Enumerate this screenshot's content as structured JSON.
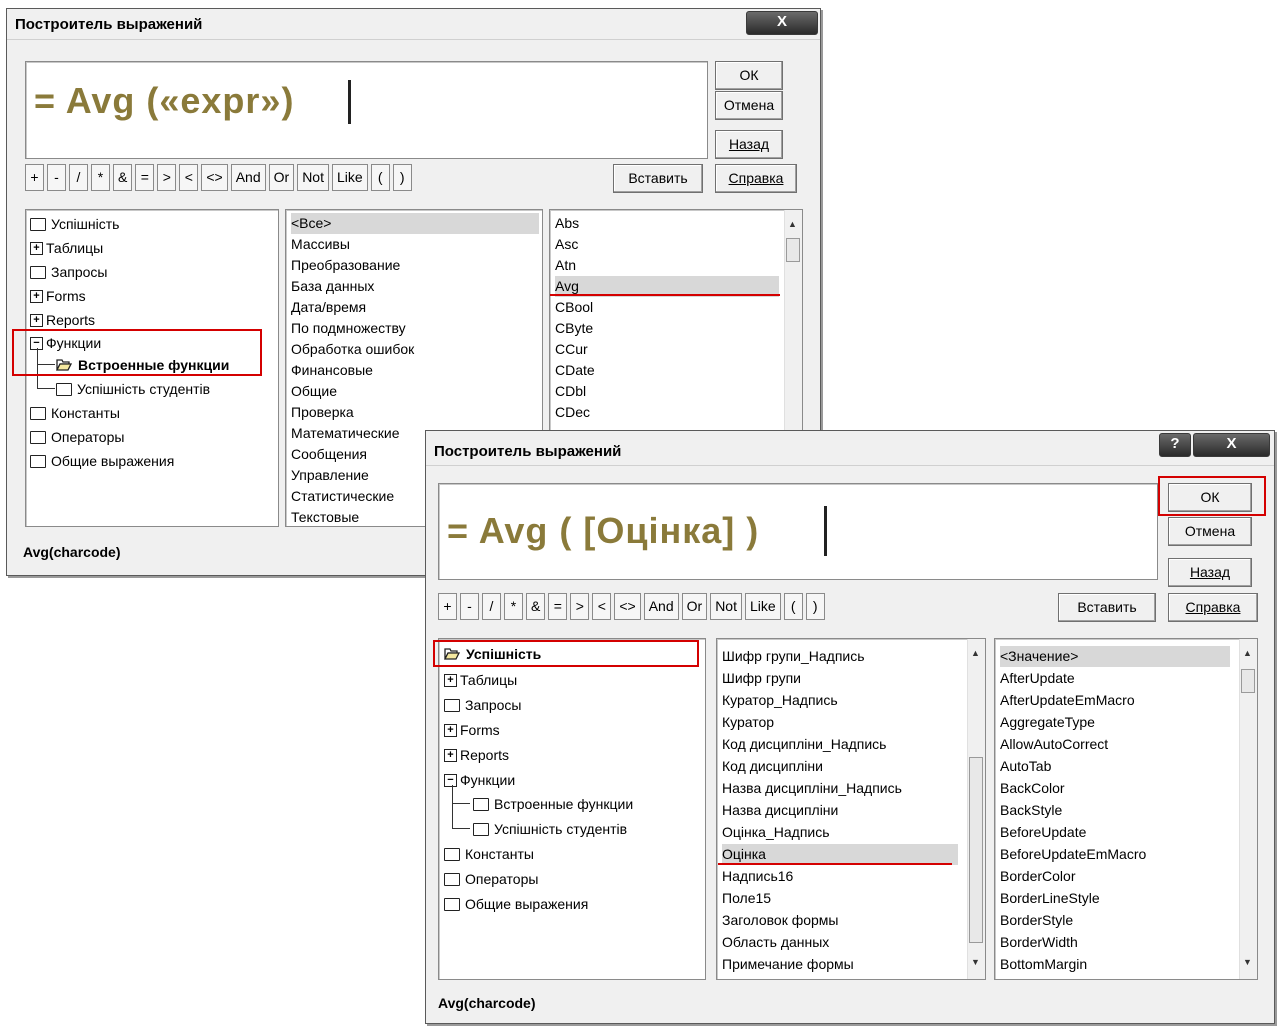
{
  "colors": {
    "highlight": "#d40000",
    "expr_text": "#8a7a3a"
  },
  "dialog1": {
    "title": "Построитель выражений",
    "close_label": "X",
    "expression": "= Avg («expr»)",
    "buttons": {
      "ok": "ОК",
      "cancel": "Отмена",
      "back": "Назад",
      "paste": "Вставить",
      "help": "Справка"
    },
    "operators": [
      "+",
      "-",
      "/",
      "*",
      "&",
      "=",
      ">",
      "<",
      "<>",
      "And",
      "Or",
      "Not",
      "Like",
      "(",
      ")"
    ],
    "tree": [
      "Успішність",
      "Таблицы",
      "Запросы",
      "Forms",
      "Reports",
      "Функции",
      "Встроенные функции",
      "Успішність студентів",
      "Константы",
      "Операторы",
      "Общие выражения"
    ],
    "categories": [
      "<Все>",
      "Массивы",
      "Преобразование",
      "База данных",
      "Дата/время",
      "По подмножеству",
      "Обработка ошибок",
      "Финансовые",
      "Общие",
      "Проверка",
      "Математические",
      "Сообщения",
      "Управление",
      "Статистические",
      "Текстовые"
    ],
    "functions": [
      "Abs",
      "Asc",
      "Atn",
      "Avg",
      "CBool",
      "CByte",
      "CCur",
      "CDate",
      "CDbl",
      "CDec"
    ],
    "status": "Avg(charcode)"
  },
  "dialog2": {
    "title": "Построитель выражений",
    "help_label": "?",
    "close_label": "X",
    "expression": "= Avg ( [Оцінка] )",
    "buttons": {
      "ok": "ОК",
      "cancel": "Отмена",
      "back": "Назад",
      "paste": "Вставить",
      "help": "Справка"
    },
    "operators": [
      "+",
      "-",
      "/",
      "*",
      "&",
      "=",
      ">",
      "<",
      "<>",
      "And",
      "Or",
      "Not",
      "Like",
      "(",
      ")"
    ],
    "tree": [
      "Успішність",
      "Таблицы",
      "Запросы",
      "Forms",
      "Reports",
      "Функции",
      "Встроенные функции",
      "Успішність студентів",
      "Константы",
      "Операторы",
      "Общие выражения"
    ],
    "fields": [
      "Шифр групи_Надпись",
      "Шифр групи",
      "Куратор_Надпись",
      "Куратор",
      "Код дисципліни_Надпись",
      "Код дисципліни",
      "Назва дисципліни_Надпись",
      "Назва дисципліни",
      "Оцінка_Надпись",
      "Оцінка",
      "Надпись16",
      "Поле15",
      "Заголовок формы",
      "Область данных",
      "Примечание формы"
    ],
    "properties": [
      "<Значение>",
      "AfterUpdate",
      "AfterUpdateEmMacro",
      "AggregateType",
      "AllowAutoCorrect",
      "AutoTab",
      "BackColor",
      "BackStyle",
      "BeforeUpdate",
      "BeforeUpdateEmMacro",
      "BorderColor",
      "BorderLineStyle",
      "BorderStyle",
      "BorderWidth",
      "BottomMargin"
    ],
    "status": "Avg(charcode)"
  }
}
